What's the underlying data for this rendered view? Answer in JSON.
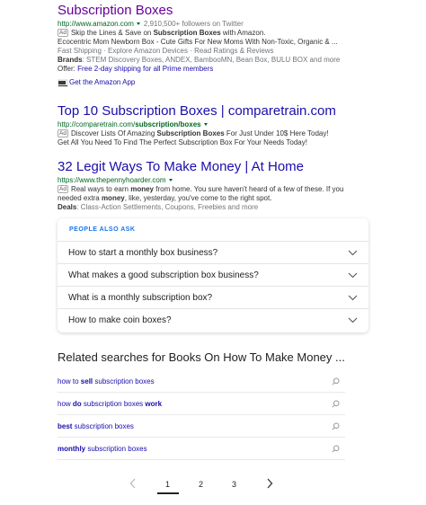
{
  "results": [
    {
      "title": "Subscription Boxes",
      "url": "http://www.amazon.com",
      "followers": "2,910,500+ followers on Twitter",
      "ad_label": "Ad",
      "line1_pre": "Skip the Lines & Save on ",
      "line1_bold": "Subscription Boxes",
      "line1_post": " with Amazon.",
      "line2": "Ecocentric Mom Newborn Box - Cute Gifts For New Moms With Non-Toxic, Organic & ...",
      "line3": "Fast Shipping · Explore Amazon Devices · Read Ratings & Reviews",
      "brands_label": "Brands",
      "brands": ": STEM Discovery Boxes, ANDEX, BambooMN, Bean Box, BULU BOX and more",
      "offer_label": "Offer: ",
      "offer": "Free 2-day shipping for all Prime members",
      "app_link": "Get the Amazon App"
    },
    {
      "title": "Top 10 Subscription Boxes | comparetrain.com",
      "url_pre": "http://comparetrain.com/",
      "url_bold": "subscription/boxes",
      "ad_label": "Ad",
      "line1_pre": "Discover Lists Of Amazing ",
      "line1_bold": "Subscription Boxes",
      "line1_post": " For Just Under 10$ Here Today!",
      "line2": "Get All You Need To Find The Perfect Subscription Box For Your Needs Today!"
    },
    {
      "title": "32 Legit Ways To Make Money | At Home",
      "url": "https://www.thepennyhoarder.com",
      "ad_label": "Ad",
      "line1_pre": "Real ways to earn ",
      "line1_bold": "money",
      "line1_post": " from home. You sure haven't heard of a few of these. If you",
      "line2_pre": "needed extra ",
      "line2_bold": "money",
      "line2_post": ", like, yesterday, you've come to the right spot.",
      "deals_label": "Deals",
      "deals": ": Class-Action Settlements, Coupons, Freebies and more"
    }
  ],
  "people_also_ask": {
    "header": "PEOPLE ALSO ASK",
    "questions": [
      "How to start a monthly box business?",
      "What makes a good subscription box business?",
      "What is a monthly subscription box?",
      "How to make coin boxes?"
    ]
  },
  "related": {
    "title": "Related searches for Books On How To Make Money ...",
    "items": [
      {
        "pre": "how to ",
        "bold": "sell",
        "post": " subscription boxes",
        "bold2": ""
      },
      {
        "pre": "how ",
        "bold": "do",
        "post": " subscription boxes ",
        "bold2": "work"
      },
      {
        "pre": "",
        "bold": "best",
        "post": " subscription boxes",
        "bold2": ""
      },
      {
        "pre": "",
        "bold": "monthly",
        "post": " subscription boxes",
        "bold2": ""
      }
    ]
  },
  "pagination": {
    "pages": [
      "1",
      "2",
      "3"
    ],
    "current": "1"
  },
  "colors": {
    "link": "#1a0dab",
    "visited": "#660099",
    "url_green": "#006621",
    "paa_header": "#1a73e8"
  }
}
